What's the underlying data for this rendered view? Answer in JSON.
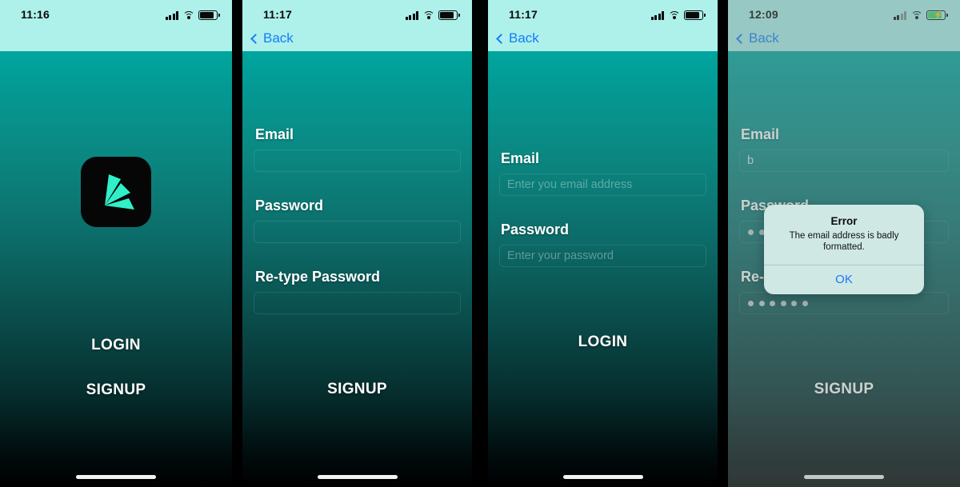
{
  "brand": {
    "accent": "#00a69e",
    "logo_cyan": "#2ff0c8",
    "ios_blue": "#147efb",
    "status_light": "#aef0ea"
  },
  "phones": [
    {
      "id": "phone-1",
      "name": "welcome-screen",
      "status": {
        "time": "11:16",
        "signal_bars": 4,
        "wifi": true,
        "battery_charging": false
      },
      "has_back": false,
      "logo": {
        "name": "app-logo-icon"
      },
      "actions": [
        {
          "label": "LOGIN",
          "name": "login-button"
        },
        {
          "label": "SIGNUP",
          "name": "signup-button"
        }
      ]
    },
    {
      "id": "phone-2",
      "name": "signup-screen-empty",
      "status": {
        "time": "11:17",
        "signal_bars": 4,
        "wifi": true,
        "battery_charging": false
      },
      "has_back": true,
      "back_label": "Back",
      "fields": [
        {
          "label": "Email",
          "value": "",
          "placeholder": "",
          "name": "email-field"
        },
        {
          "label": "Password",
          "value": "",
          "placeholder": "",
          "name": "password-field"
        },
        {
          "label": "Re-type Password",
          "value": "",
          "placeholder": "",
          "name": "retype-password-field"
        }
      ],
      "actions": [
        {
          "label": "SIGNUP",
          "name": "signup-button"
        }
      ]
    },
    {
      "id": "phone-3",
      "name": "login-screen",
      "status": {
        "time": "11:17",
        "signal_bars": 4,
        "wifi": true,
        "battery_charging": false
      },
      "has_back": true,
      "back_label": "Back",
      "fields": [
        {
          "label": "Email",
          "value": "",
          "placeholder": "Enter you email address",
          "name": "email-field"
        },
        {
          "label": "Password",
          "value": "",
          "placeholder": "Enter your password",
          "name": "password-field"
        }
      ],
      "actions": [
        {
          "label": "LOGIN",
          "name": "login-button"
        }
      ]
    },
    {
      "id": "phone-4",
      "name": "signup-screen-error",
      "status": {
        "time": "12:09",
        "signal_bars": 2,
        "wifi": true,
        "battery_charging": true
      },
      "has_back": true,
      "back_label": "Back",
      "fields": [
        {
          "label": "Email",
          "value": "b",
          "placeholder": "",
          "name": "email-field"
        },
        {
          "label": "Password",
          "value": "",
          "placeholder": "",
          "masked_dots": 3,
          "name": "password-field"
        },
        {
          "label": "Re-type Password",
          "value": "",
          "placeholder": "",
          "masked_dots": 6,
          "name": "retype-password-field"
        }
      ],
      "actions": [
        {
          "label": "SIGNUP",
          "name": "signup-button"
        }
      ],
      "alert": {
        "title": "Error",
        "message": "The email address is badly formatted.",
        "ok_label": "OK"
      }
    }
  ]
}
